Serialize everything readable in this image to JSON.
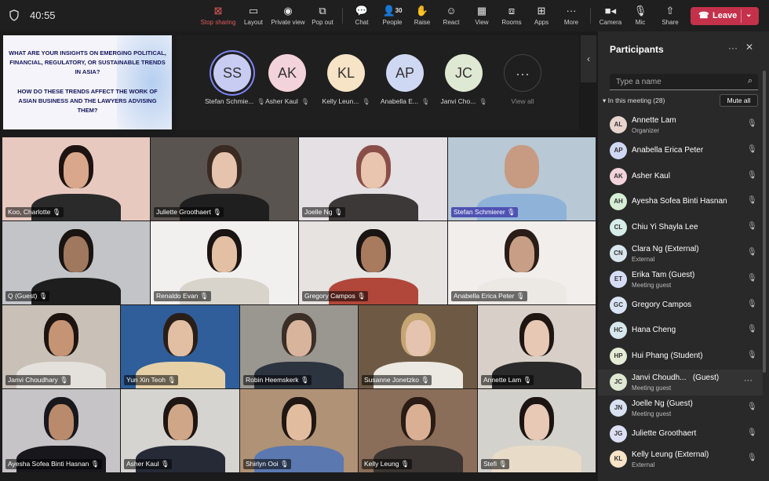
{
  "topbar": {
    "timer": "40:55",
    "buttons": {
      "stop_sharing": "Stop sharing",
      "layout": "Layout",
      "private_view": "Private view",
      "pop_out": "Pop out",
      "chat": "Chat",
      "people": "People",
      "people_count": "30",
      "raise": "Raise",
      "react": "React",
      "view": "View",
      "rooms": "Rooms",
      "apps": "Apps",
      "more": "More",
      "camera": "Camera",
      "mic": "Mic",
      "share": "Share"
    },
    "leave": "Leave"
  },
  "slide": {
    "question1": "What are your insights on emerging political, financial, regulatory, or sustainable trends in Asia?",
    "question2": "How do these trends affect the work of Asian business and the lawyers advising them?"
  },
  "avatars": [
    {
      "initials": "SS",
      "name": "Stefan Schmie...",
      "color": "#c8cbf2"
    },
    {
      "initials": "AK",
      "name": "Asher Kaul",
      "color": "#f3d3db"
    },
    {
      "initials": "KL",
      "name": "Kelly Leun...",
      "color": "#f7e3c5"
    },
    {
      "initials": "AP",
      "name": "Anabella E...",
      "color": "#cfd8f3"
    },
    {
      "initials": "JC",
      "name": "Janvi Cho...",
      "color": "#dfe8d2"
    }
  ],
  "view_all": "View all",
  "tiles": [
    {
      "name": "Koo, Charlotte",
      "bg": "#e8c9c0",
      "skin": "#d9a88c",
      "hair": "#1d1411",
      "cloth": "#2a2a2a"
    },
    {
      "name": "Juliette Groothaert",
      "bg": "#5a5450",
      "skin": "#e6c3ad",
      "hair": "#3a2a22",
      "cloth": "#1f1f1f"
    },
    {
      "name": "Joelle Ng",
      "bg": "#e4e0e3",
      "skin": "#e9c5b0",
      "hair": "#8a4e48",
      "cloth": "#3c3838"
    },
    {
      "name": "Stefan Schmierer",
      "bg": "#b8c8d4",
      "skin": "#c79a82",
      "hair": "#c79a82",
      "cloth": "#8fb3d8"
    },
    {
      "name": "Q (Guest)",
      "bg": "#c2c4c8",
      "skin": "#a0785e",
      "hair": "#1a1412",
      "cloth": "#1e1e1e"
    },
    {
      "name": "Renaldo Evan",
      "bg": "#f2f0ef",
      "skin": "#e3bfa4",
      "hair": "#1a1412",
      "cloth": "#d8d4cc"
    },
    {
      "name": "Gregory Campos",
      "bg": "#e6e3e0",
      "skin": "#a87b5e",
      "hair": "#1a1412",
      "cloth": "#b0473a"
    },
    {
      "name": "Anabella Erica Peter",
      "bg": "#f1eeec",
      "skin": "#c89f86",
      "hair": "#2a1c16",
      "cloth": "#ece8e4"
    },
    {
      "name": "Janvi Choudhary",
      "bg": "#c9c0b8",
      "skin": "#c49474",
      "hair": "#1d1411",
      "cloth": "#e4e0dc"
    },
    {
      "name": "Yun Xin Teoh",
      "bg": "#2f5e9a",
      "skin": "#e2bea2",
      "hair": "#2a1e18",
      "cloth": "#e6d0a8"
    },
    {
      "name": "Robin Heemskerk",
      "bg": "#9a9690",
      "skin": "#d9b49c",
      "hair": "#3a2e26",
      "cloth": "#2c3440"
    },
    {
      "name": "Susanne Jonetzko",
      "bg": "#6e5a44",
      "skin": "#e4c4ae",
      "hair": "#c6a574",
      "cloth": "#ece8e2"
    },
    {
      "name": "Annette Lam",
      "bg": "#d8d0c8",
      "skin": "#e7c8b4",
      "hair": "#1f1612",
      "cloth": "#2a2a2a"
    },
    {
      "name": "Ayesha Sofea Binti Hasnan",
      "bg": "#c6c4c6",
      "skin": "#b98a6c",
      "hair": "#18181c",
      "cloth": "#18181c"
    },
    {
      "name": "Asher Kaul",
      "bg": "#d6d4d0",
      "skin": "#d0a688",
      "hair": "#1e1612",
      "cloth": "#252a36"
    },
    {
      "name": "Shirlyn Ooi",
      "bg": "#b09276",
      "skin": "#e2bc9e",
      "hair": "#201612",
      "cloth": "#5b78b0"
    },
    {
      "name": "Kelly Leung",
      "bg": "#8a6e5a",
      "skin": "#d9b094",
      "hair": "#2a1c14",
      "cloth": "#3a3432"
    },
    {
      "name": "Stefi",
      "bg": "#d4d2cc",
      "skin": "#e7c9b6",
      "hair": "#1c1412",
      "cloth": "#e8dcc8"
    }
  ],
  "panel": {
    "title": "Participants",
    "search_placeholder": "Type a name",
    "in_meeting": "In this meeting (28)",
    "mute_all": "Mute all",
    "participants": [
      {
        "initials": "AL",
        "name": "Annette Lam",
        "sub": "Organizer",
        "color": "#e8d3cf"
      },
      {
        "initials": "AP",
        "name": "Anabella Erica Peter",
        "sub": "",
        "color": "#cfd8f3"
      },
      {
        "initials": "AK",
        "name": "Asher Kaul",
        "sub": "",
        "color": "#f3d3db"
      },
      {
        "initials": "AH",
        "name": "Ayesha Sofea Binti Hasnan",
        "sub": "",
        "color": "#d6eed6"
      },
      {
        "initials": "CL",
        "name": "Chiu Yi Shayla Lee",
        "sub": "",
        "color": "#d6ece6"
      },
      {
        "initials": "CN",
        "name": "Clara Ng (External)",
        "sub": "External",
        "color": "#d8e6ee"
      },
      {
        "initials": "ET",
        "name": "Erika Tam (Guest)",
        "sub": "Meeting guest",
        "color": "#d6dcf4"
      },
      {
        "initials": "GC",
        "name": "Gregory Campos",
        "sub": "",
        "color": "#d8e4f4"
      },
      {
        "initials": "HC",
        "name": "Hana Cheng",
        "sub": "",
        "color": "#d6e8ee"
      },
      {
        "initials": "HP",
        "name": "Hui Phang (Student)",
        "sub": "",
        "color": "#e4ecd6"
      },
      {
        "initials": "JC",
        "name": "Janvi Choudh...",
        "name_suffix": "(Guest)",
        "sub": "Meeting guest",
        "color": "#dfe8d2"
      },
      {
        "initials": "JN",
        "name": "Joelle Ng (Guest)",
        "sub": "Meeting guest",
        "color": "#d8e2f2"
      },
      {
        "initials": "JG",
        "name": "Juliette Groothaert",
        "sub": "",
        "color": "#dde0f4"
      },
      {
        "initials": "KL",
        "name": "Kelly Leung (External)",
        "sub": "External",
        "color": "#f7e3c5"
      }
    ]
  }
}
